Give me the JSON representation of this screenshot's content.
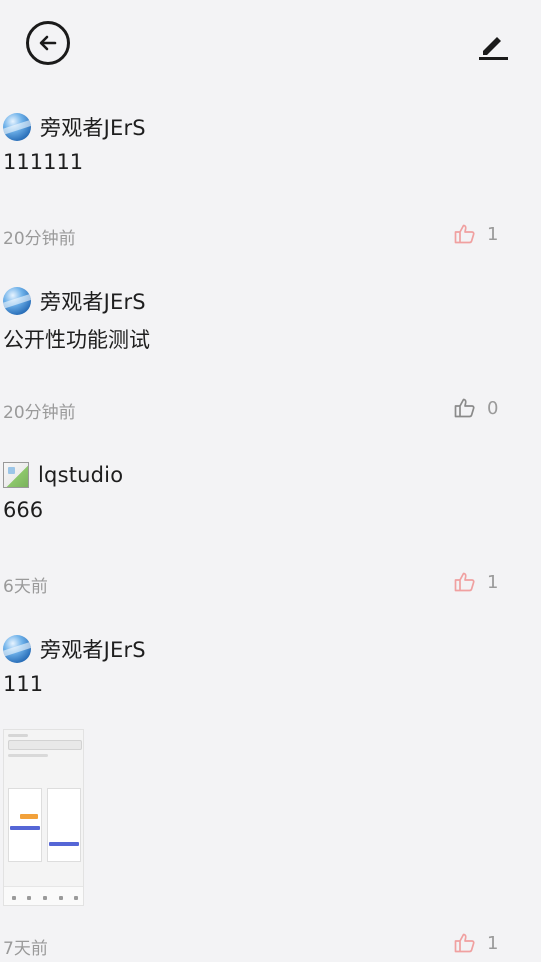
{
  "header": {
    "back_icon": "arrow-left-circle-icon",
    "edit_icon": "pencil-icon"
  },
  "colors": {
    "liked": "#f0a0a0",
    "unliked": "#8a8a8a",
    "meta_text": "#9a9a9a"
  },
  "posts": [
    {
      "author": "旁观者JErS",
      "content": "111111",
      "time": "20分钟前",
      "likes": "1",
      "liked": true
    },
    {
      "author": "旁观者JErS",
      "content": "公开性功能测试",
      "time": "20分钟前",
      "likes": "0",
      "liked": false
    },
    {
      "author": "lqstudio",
      "content": "666",
      "time": "6天前",
      "likes": "1",
      "liked": true
    },
    {
      "author": "旁观者JErS",
      "content": "111",
      "time": "7天前",
      "likes": "1",
      "liked": true,
      "has_image": true
    }
  ]
}
